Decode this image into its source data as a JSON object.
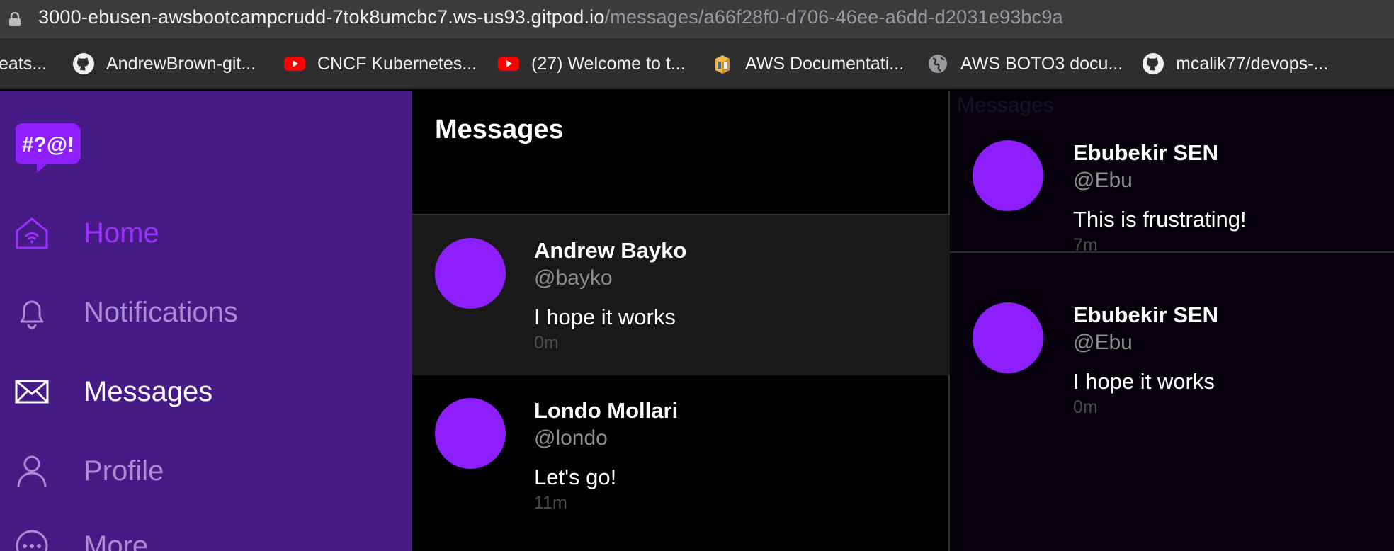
{
  "browser": {
    "url_host": "3000-ebusen-awsbootcampcrudd-7tok8umcbc7.ws-us93.gitpod.io",
    "url_path": "/messages/a66f28f0-d706-46ee-a6dd-d2031e93bc9a",
    "bookmarks": [
      {
        "label": "eats...",
        "icon": ""
      },
      {
        "label": "AndrewBrown-git...",
        "icon": "github-icon"
      },
      {
        "label": "CNCF Kubernetes...",
        "icon": "youtube-icon"
      },
      {
        "label": "(27) Welcome to t...",
        "icon": "youtube-icon"
      },
      {
        "label": "AWS Documentati...",
        "icon": "aws-docs-icon"
      },
      {
        "label": "AWS BOTO3 docu...",
        "icon": "globe-icon"
      },
      {
        "label": "mcalik77/devops-...",
        "icon": "github-icon"
      }
    ]
  },
  "app": {
    "logo_text": "#?@!",
    "nav": [
      {
        "label": "Home",
        "icon": "home-icon"
      },
      {
        "label": "Notifications",
        "icon": "bell-icon"
      },
      {
        "label": "Messages",
        "icon": "envelope-icon"
      },
      {
        "label": "Profile",
        "icon": "person-icon"
      },
      {
        "label": "More",
        "icon": "more-icon"
      }
    ],
    "center": {
      "title": "Messages",
      "groups": [
        {
          "name": "Andrew Bayko",
          "handle": "@bayko",
          "message": "I hope it works",
          "time": "0m"
        },
        {
          "name": "Londo Mollari",
          "handle": "@londo",
          "message": "Let's go!",
          "time": "11m"
        }
      ]
    },
    "right": {
      "title": "Messages",
      "messages": [
        {
          "name": "Ebubekir SEN",
          "handle": "@Ebu",
          "message": "This is frustrating!",
          "time": "7m"
        },
        {
          "name": "Ebubekir SEN",
          "handle": "@Ebu",
          "message": "I hope it works",
          "time": "0m"
        }
      ]
    },
    "colors": {
      "sidebar_bg": "#461b85",
      "accent": "#8c1ffc",
      "home_active": "#9b30ff"
    }
  }
}
